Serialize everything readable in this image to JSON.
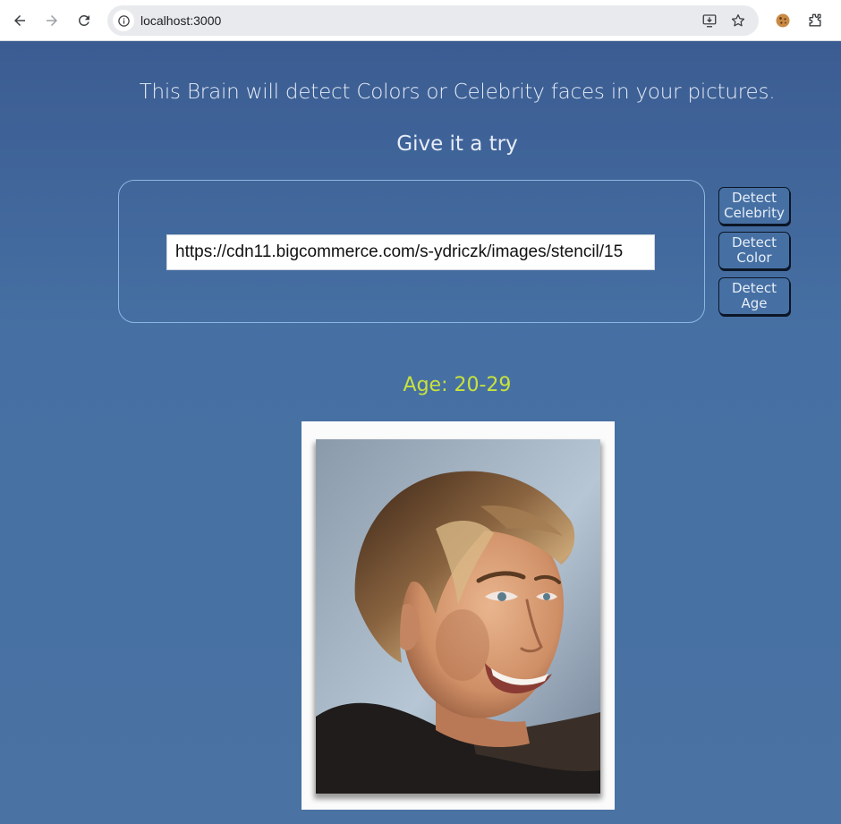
{
  "browser": {
    "url": "localhost:3000",
    "icons": {
      "back": "back-arrow-icon",
      "forward": "forward-arrow-icon",
      "reload": "reload-icon",
      "site_info": "info-icon",
      "install": "install-app-icon",
      "bookmark": "star-icon",
      "cookie_extension": "cookie-icon",
      "extensions": "puzzle-icon"
    }
  },
  "page": {
    "headline": "This Brain will detect Colors or Celebrity faces in your pictures.",
    "subhead": "Give it a try",
    "image_url_input": {
      "value": "https://cdn11.bigcommerce.com/s-ydriczk/images/stencil/15"
    },
    "buttons": [
      {
        "line1": "Detect",
        "line2": "Celebrity"
      },
      {
        "line1": "Detect",
        "line2": "Color"
      },
      {
        "line1": "Detect",
        "line2": "Age"
      }
    ],
    "result": "Age: 20-29"
  },
  "colors": {
    "background": "#4a72a3",
    "panel_border": "#8fb6e3",
    "result_text": "#c8e23b",
    "text": "#e6edf7"
  }
}
